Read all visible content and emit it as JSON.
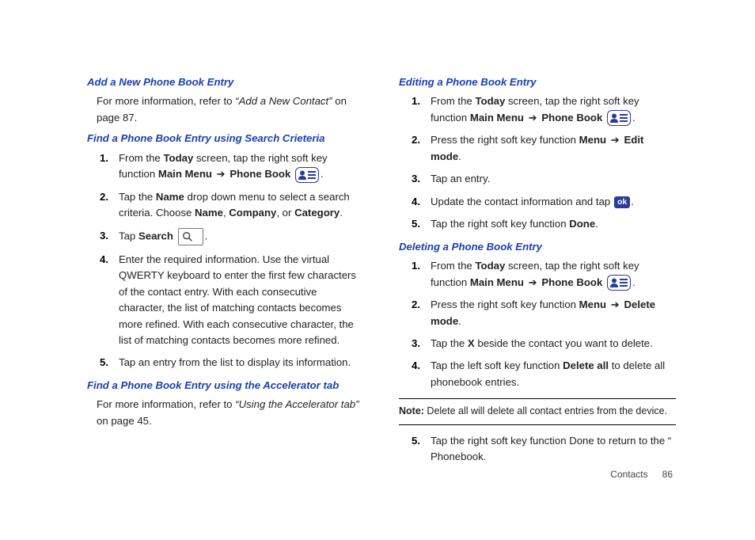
{
  "left": {
    "h_add": "Add a New Phone Book Entry",
    "p_add_1": "For more information, refer to ",
    "p_add_ref": "“Add a New Contact”",
    "p_add_2": "  on page 87.",
    "h_find_search": "Find a Phone Book Entry using Search Crieteria",
    "fs1_a": "From the ",
    "fs1_today": "Today",
    "fs1_b": " screen, tap the right soft key function ",
    "fs1_mm": "Main Menu",
    "fs1_arrow": " ➔ ",
    "fs1_pb": "Phone Book",
    "fs1_period": ".",
    "fs2_a": "Tap the ",
    "fs2_name": "Name",
    "fs2_b": " drop down menu to select a search criteria. Choose ",
    "fs2_name2": "Name",
    "fs2_comma_company": ", ",
    "fs2_company": "Company",
    "fs2_comma_cat": ", or ",
    "fs2_category": "Category",
    "fs2_period": ".",
    "fs3_a": "Tap ",
    "fs3_search": "Search",
    "fs3_period": ".",
    "fs4": "Enter the required information. Use the virtual QWERTY keyboard to enter the first few characters of the contact entry. With each consecutive character, the list of matching contacts becomes more refined. With each consecutive character, the list of matching contacts becomes more refined.",
    "fs5": "Tap an entry from the list to display its information.",
    "h_find_accel": "Find a Phone Book Entry using the Accelerator tab",
    "p_accel_1": "For more information, refer to ",
    "p_accel_ref": "“Using the Accelerator tab”",
    "p_accel_2": "  on page 45."
  },
  "right": {
    "h_edit": "Editing a Phone Book Entry",
    "e1_a": "From the ",
    "e1_today": "Today",
    "e1_b": " screen, tap the right soft key function ",
    "e1_mm": "Main Menu",
    "e1_arrow": " ➔ ",
    "e1_pb": "Phone Book",
    "e1_period": ".",
    "e2_a": "Press the right soft key function ",
    "e2_menu": "Menu",
    "e2_arrow": " ➔ ",
    "e2_edit": "Edit mode",
    "e2_period": ".",
    "e3": "Tap an entry.",
    "e4_a": "Update the contact information and tap ",
    "e4_ok": "ok",
    "e4_period": ".",
    "e5_a": "Tap the right soft key function ",
    "e5_done": "Done",
    "e5_period": ".",
    "h_delete": "Deleting a Phone Book Entry",
    "d1_a": "From the ",
    "d1_today": "Today",
    "d1_b": " screen, tap the right soft key function ",
    "d1_mm": "Main Menu",
    "d1_arrow": " ➔ ",
    "d1_pb": "Phone Book",
    "d1_period": ".",
    "d2_a": "Press the right soft key function ",
    "d2_menu": "Menu",
    "d2_arrow": " ➔ ",
    "d2_del": "Delete mode",
    "d2_period": ".",
    "d3_a": "Tap the ",
    "d3_x": "X",
    "d3_b": " beside the contact you want to delete.",
    "d4_a": "Tap the left soft key function ",
    "d4_delall": "Delete all",
    "d4_b": " to delete all phonebook entries.",
    "note_label": "Note: ",
    "note_text": "Delete all will delete all contact entries from the device.",
    "d5": "Tap the right soft key function Done to return to the “ Phonebook."
  },
  "footer": {
    "section": "Contacts",
    "page": "86"
  }
}
